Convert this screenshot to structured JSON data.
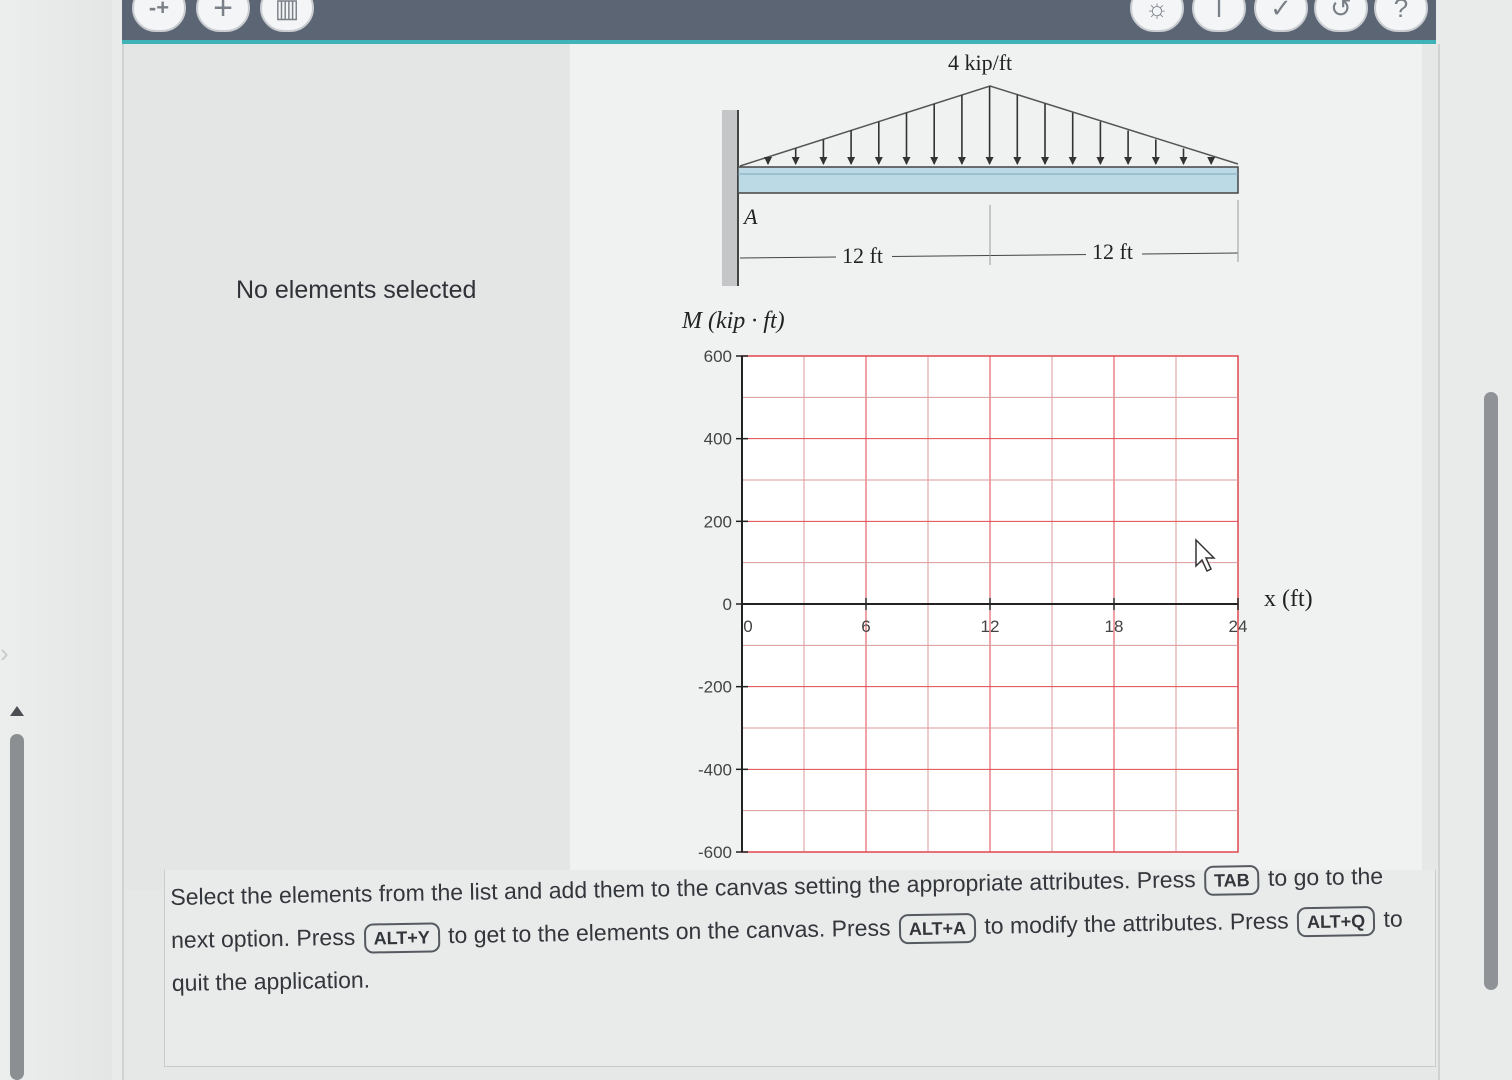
{
  "toolbar": {
    "left_buttons": [
      {
        "name": "add-point-icon",
        "glyph": "-+"
      },
      {
        "name": "add-icon",
        "glyph": "+"
      },
      {
        "name": "delete-icon",
        "glyph": "▥"
      }
    ],
    "right_buttons": [
      {
        "name": "hint-bulb-icon",
        "glyph": "☼"
      },
      {
        "name": "info-icon",
        "glyph": "ǀ"
      },
      {
        "name": "check-icon",
        "glyph": "✓"
      },
      {
        "name": "undo-icon",
        "glyph": "↺"
      },
      {
        "name": "help-icon",
        "glyph": "?"
      }
    ]
  },
  "attributes_panel": {
    "empty_text": "No elements selected"
  },
  "beam": {
    "load_label": "4 kip/ft",
    "support_label": "A",
    "span_left": "12 ft",
    "span_right": "12 ft"
  },
  "chart_data": {
    "type": "line",
    "ylabel": "M (kip · ft)",
    "xlabel": "x (ft)",
    "xlim": [
      0,
      24
    ],
    "ylim": [
      -600,
      600
    ],
    "x_ticks": [
      "0",
      "6",
      "12",
      "18",
      "24"
    ],
    "y_ticks": [
      "600",
      "400",
      "200",
      "0",
      "-200",
      "-400",
      "-600"
    ],
    "x_grid_step": 3,
    "y_grid_step": 100,
    "grid": true,
    "series": []
  },
  "instructions": {
    "p1": "Select the elements from the list and add them to the canvas setting the appropriate attributes. Press",
    "k1": "TAB",
    "p2": "to go to the next option. Press",
    "k2": "ALT+Y",
    "p3": "to get to the elements on the canvas. Press",
    "k3": "ALT+A",
    "p4": "to modify the attributes. Press",
    "k4": "ALT+Q",
    "p5": "to quit the application."
  },
  "colors": {
    "toolbar": "#5b6573",
    "toolbar_accent": "#3fb3b5",
    "grid_red": "#e0474c",
    "beam_fill": "#bcd9e6"
  }
}
